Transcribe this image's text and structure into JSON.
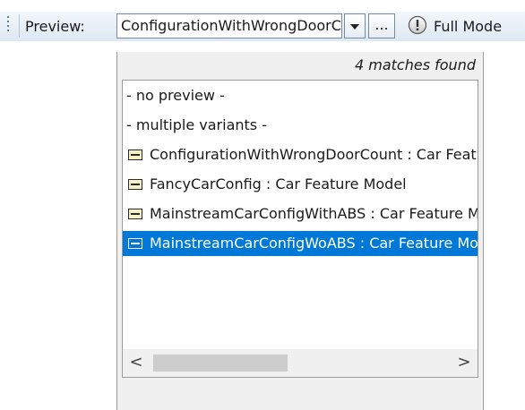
{
  "toolbar": {
    "preview_label": "Preview:",
    "combo_value": "ConfigurationWithWrongDoorCount",
    "more_button_label": "...",
    "mode_label": "Full Mode",
    "mode_icon": "info-circle-icon",
    "dropdown_icon": "triangle-down-icon"
  },
  "popup": {
    "matches_text": "4 matches found",
    "items": [
      {
        "label": "- no preview -",
        "icon": ""
      },
      {
        "label": "- multiple variants -",
        "icon": ""
      },
      {
        "label": "ConfigurationWithWrongDoorCount : Car Feature Model",
        "icon": "configuration-icon"
      },
      {
        "label": "FancyCarConfig : Car Feature Model",
        "icon": "configuration-icon"
      },
      {
        "label": "MainstreamCarConfigWithABS : Car Feature Model",
        "icon": "configuration-icon"
      },
      {
        "label": "MainstreamCarConfigWoABS : Car Feature Model",
        "icon": "configuration-icon",
        "selected": true
      }
    ],
    "scroll_left": "<",
    "scroll_right": ">"
  },
  "colors": {
    "selection": "#0078d7",
    "toolbar_top": "#f3f7fb",
    "toolbar_bottom": "#dde8f3"
  }
}
